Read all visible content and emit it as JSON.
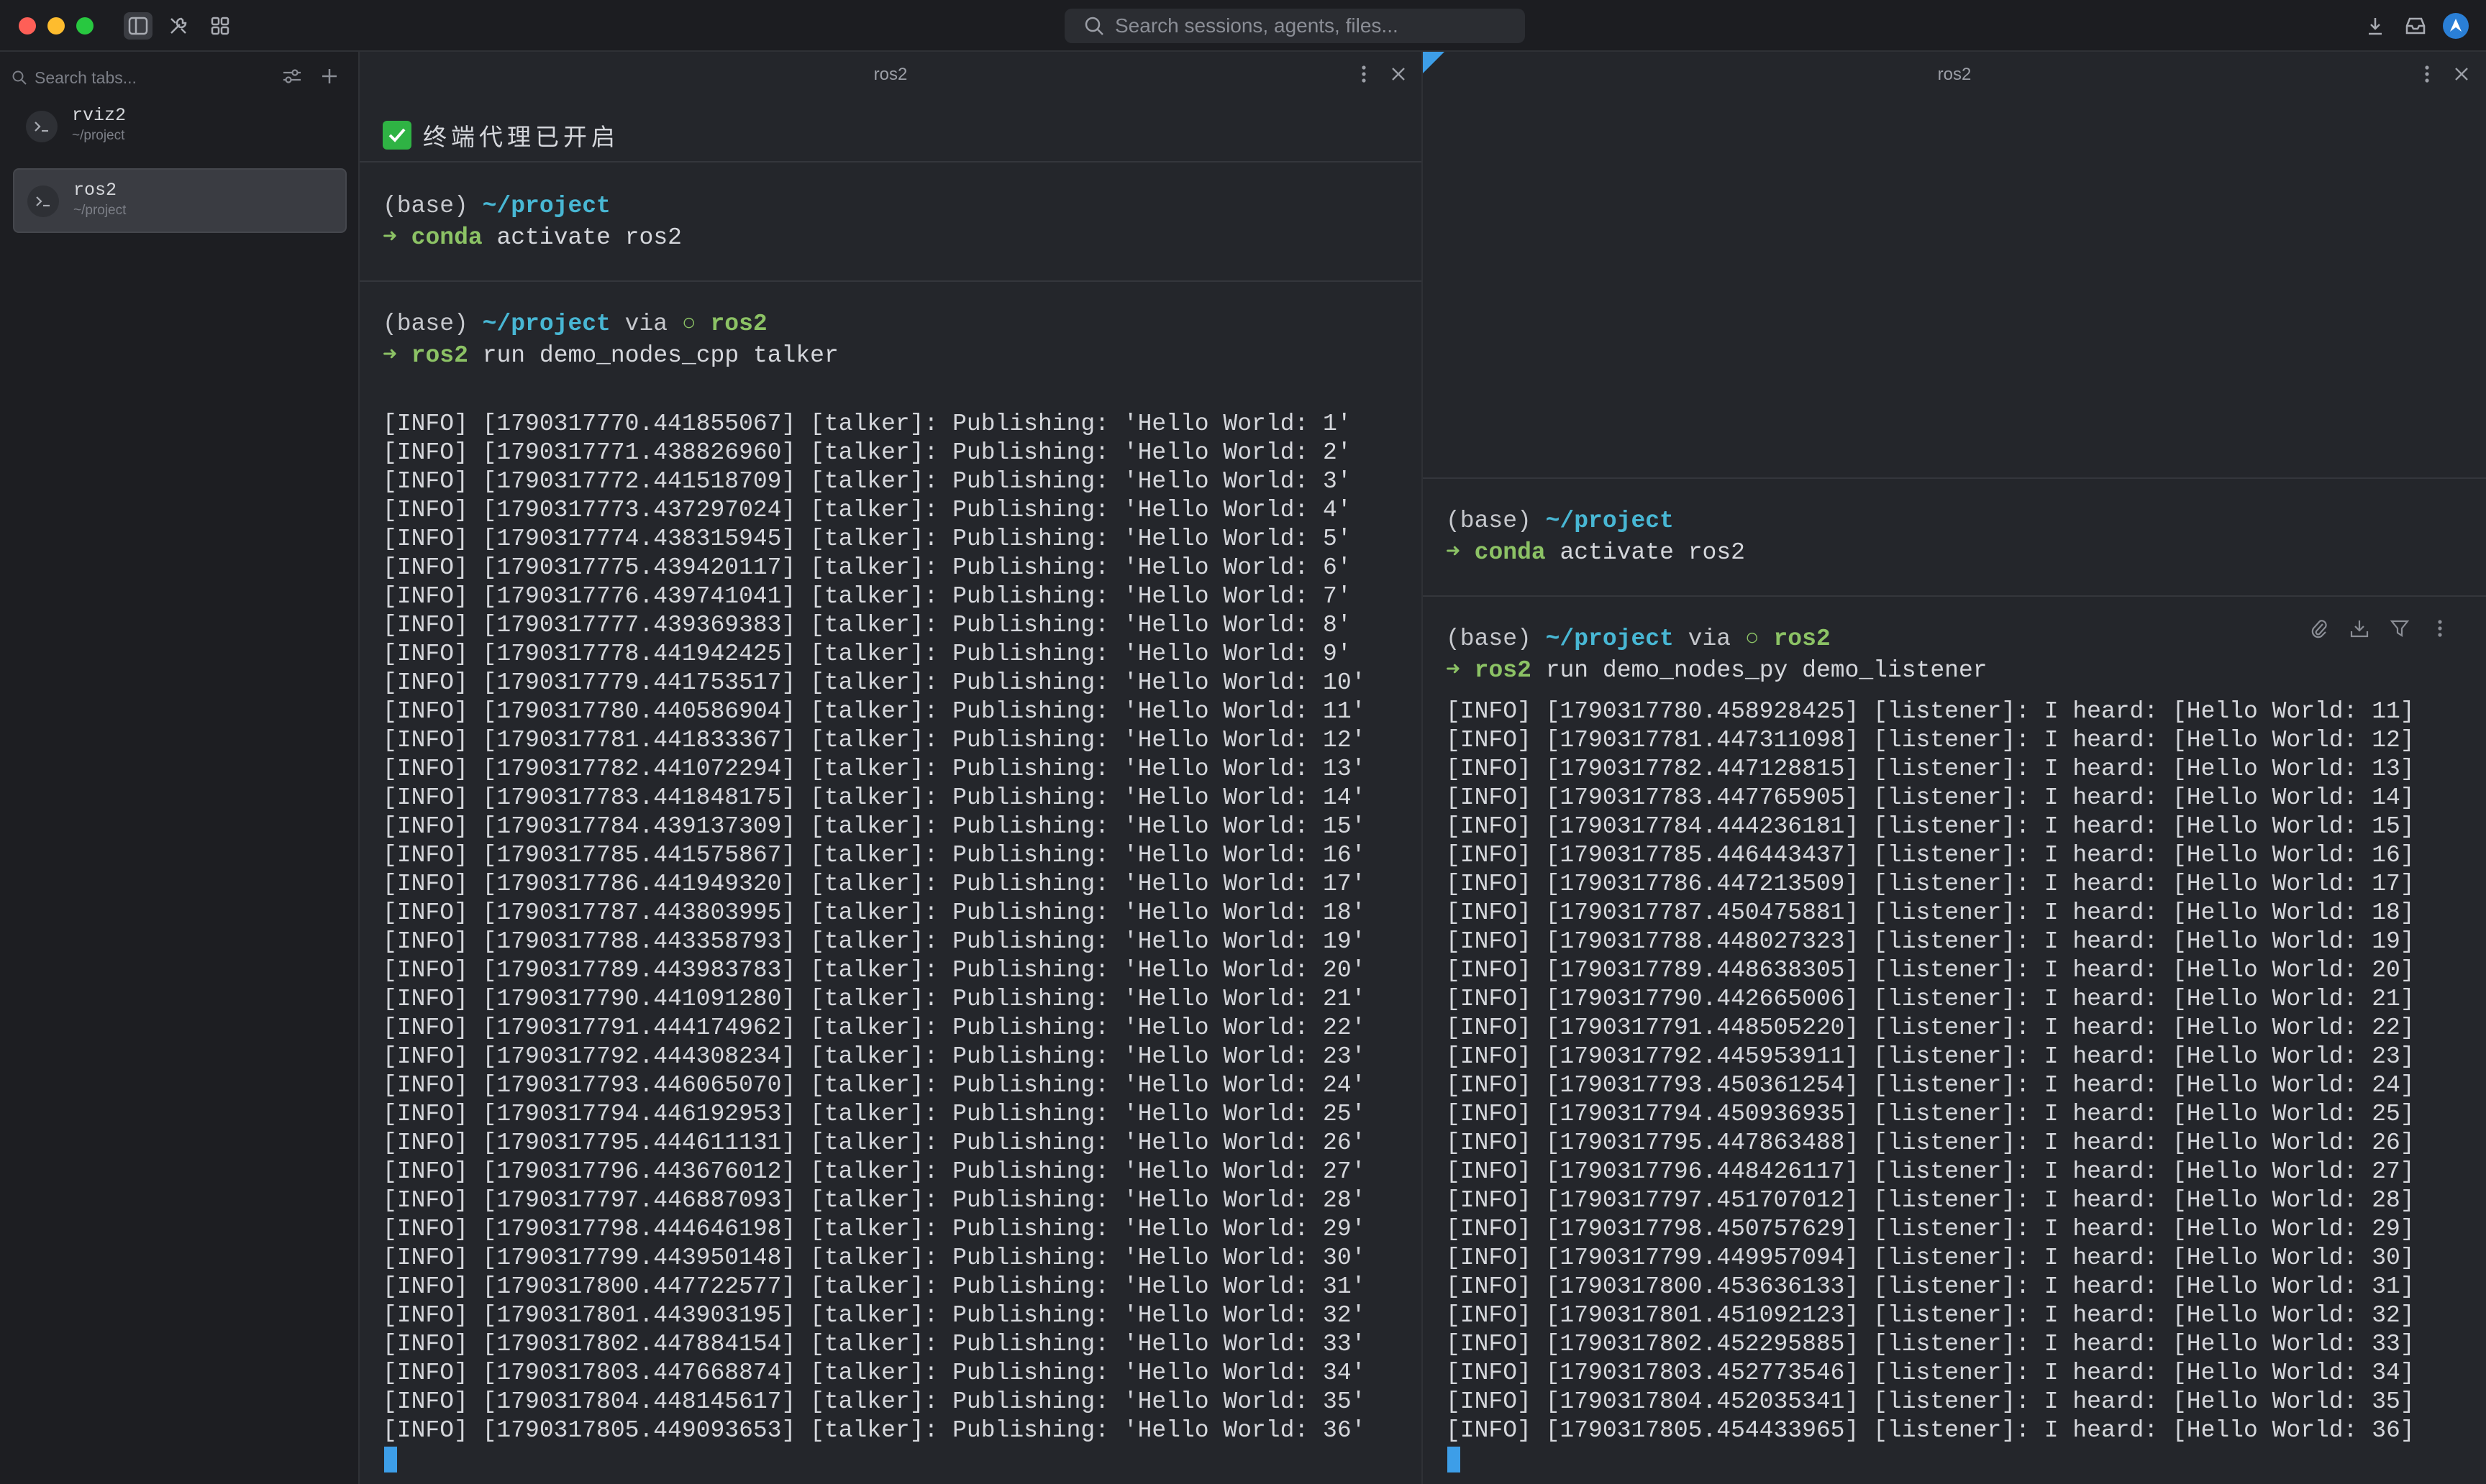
{
  "search": {
    "placeholder": "Search sessions, agents, files..."
  },
  "sidebar": {
    "search_placeholder": "Search tabs...",
    "sessions": [
      {
        "name": "rviz2",
        "path": "~/project",
        "active": false
      },
      {
        "name": "ros2",
        "path": "~/project",
        "active": true
      }
    ]
  },
  "left_pane": {
    "title": "ros2",
    "agent_banner": "终端代理已开启",
    "block1": {
      "prefix": "(base) ",
      "path": "~/project",
      "arrow": "➜ ",
      "cmd": "conda",
      "args": " activate ros2"
    },
    "block2": {
      "prefix": "(base) ",
      "path": "~/project",
      "via": " via ",
      "sym": "○ ",
      "env": "ros2",
      "arrow": "➜ ",
      "cmd": "ros2",
      "args": " run demo_nodes_cpp talker"
    },
    "logs": [
      "[INFO] [1790317770.441855067] [talker]: Publishing: 'Hello World: 1'",
      "[INFO] [1790317771.438826960] [talker]: Publishing: 'Hello World: 2'",
      "[INFO] [1790317772.441518709] [talker]: Publishing: 'Hello World: 3'",
      "[INFO] [1790317773.437297024] [talker]: Publishing: 'Hello World: 4'",
      "[INFO] [1790317774.438315945] [talker]: Publishing: 'Hello World: 5'",
      "[INFO] [1790317775.439420117] [talker]: Publishing: 'Hello World: 6'",
      "[INFO] [1790317776.439741041] [talker]: Publishing: 'Hello World: 7'",
      "[INFO] [1790317777.439369383] [talker]: Publishing: 'Hello World: 8'",
      "[INFO] [1790317778.441942425] [talker]: Publishing: 'Hello World: 9'",
      "[INFO] [1790317779.441753517] [talker]: Publishing: 'Hello World: 10'",
      "[INFO] [1790317780.440586904] [talker]: Publishing: 'Hello World: 11'",
      "[INFO] [1790317781.441833367] [talker]: Publishing: 'Hello World: 12'",
      "[INFO] [1790317782.441072294] [talker]: Publishing: 'Hello World: 13'",
      "[INFO] [1790317783.441848175] [talker]: Publishing: 'Hello World: 14'",
      "[INFO] [1790317784.439137309] [talker]: Publishing: 'Hello World: 15'",
      "[INFO] [1790317785.441575867] [talker]: Publishing: 'Hello World: 16'",
      "[INFO] [1790317786.441949320] [talker]: Publishing: 'Hello World: 17'",
      "[INFO] [1790317787.443803995] [talker]: Publishing: 'Hello World: 18'",
      "[INFO] [1790317788.443358793] [talker]: Publishing: 'Hello World: 19'",
      "[INFO] [1790317789.443983783] [talker]: Publishing: 'Hello World: 20'",
      "[INFO] [1790317790.441091280] [talker]: Publishing: 'Hello World: 21'",
      "[INFO] [1790317791.444174962] [talker]: Publishing: 'Hello World: 22'",
      "[INFO] [1790317792.444308234] [talker]: Publishing: 'Hello World: 23'",
      "[INFO] [1790317793.446065070] [talker]: Publishing: 'Hello World: 24'",
      "[INFO] [1790317794.446192953] [talker]: Publishing: 'Hello World: 25'",
      "[INFO] [1790317795.444611131] [talker]: Publishing: 'Hello World: 26'",
      "[INFO] [1790317796.443676012] [talker]: Publishing: 'Hello World: 27'",
      "[INFO] [1790317797.446887093] [talker]: Publishing: 'Hello World: 28'",
      "[INFO] [1790317798.444646198] [talker]: Publishing: 'Hello World: 29'",
      "[INFO] [1790317799.443950148] [talker]: Publishing: 'Hello World: 30'",
      "[INFO] [1790317800.447722577] [talker]: Publishing: 'Hello World: 31'",
      "[INFO] [1790317801.443903195] [talker]: Publishing: 'Hello World: 32'",
      "[INFO] [1790317802.447884154] [talker]: Publishing: 'Hello World: 33'",
      "[INFO] [1790317803.447668874] [talker]: Publishing: 'Hello World: 34'",
      "[INFO] [1790317804.448145617] [talker]: Publishing: 'Hello World: 35'",
      "[INFO] [1790317805.449093653] [talker]: Publishing: 'Hello World: 36'"
    ]
  },
  "right_pane": {
    "title": "ros2",
    "block1": {
      "prefix": "(base) ",
      "path": "~/project",
      "arrow": "➜ ",
      "cmd": "conda",
      "args": " activate ros2"
    },
    "block2": {
      "prefix": "(base) ",
      "path": "~/project",
      "via": " via ",
      "sym": "○ ",
      "env": "ros2",
      "arrow": "➜ ",
      "cmd": "ros2",
      "args": " run demo_nodes_py demo_listener"
    },
    "logs": [
      "[INFO] [1790317780.458928425] [listener]: I heard: [Hello World: 11]",
      "[INFO] [1790317781.447311098] [listener]: I heard: [Hello World: 12]",
      "[INFO] [1790317782.447128815] [listener]: I heard: [Hello World: 13]",
      "[INFO] [1790317783.447765905] [listener]: I heard: [Hello World: 14]",
      "[INFO] [1790317784.444236181] [listener]: I heard: [Hello World: 15]",
      "[INFO] [1790317785.446443437] [listener]: I heard: [Hello World: 16]",
      "[INFO] [1790317786.447213509] [listener]: I heard: [Hello World: 17]",
      "[INFO] [1790317787.450475881] [listener]: I heard: [Hello World: 18]",
      "[INFO] [1790317788.448027323] [listener]: I heard: [Hello World: 19]",
      "[INFO] [1790317789.448638305] [listener]: I heard: [Hello World: 20]",
      "[INFO] [1790317790.442665006] [listener]: I heard: [Hello World: 21]",
      "[INFO] [1790317791.448505220] [listener]: I heard: [Hello World: 22]",
      "[INFO] [1790317792.445953911] [listener]: I heard: [Hello World: 23]",
      "[INFO] [1790317793.450361254] [listener]: I heard: [Hello World: 24]",
      "[INFO] [1790317794.450936935] [listener]: I heard: [Hello World: 25]",
      "[INFO] [1790317795.447863488] [listener]: I heard: [Hello World: 26]",
      "[INFO] [1790317796.448426117] [listener]: I heard: [Hello World: 27]",
      "[INFO] [1790317797.451707012] [listener]: I heard: [Hello World: 28]",
      "[INFO] [1790317798.450757629] [listener]: I heard: [Hello World: 29]",
      "[INFO] [1790317799.449957094] [listener]: I heard: [Hello World: 30]",
      "[INFO] [1790317800.453636133] [listener]: I heard: [Hello World: 31]",
      "[INFO] [1790317801.451092123] [listener]: I heard: [Hello World: 32]",
      "[INFO] [1790317802.452295885] [listener]: I heard: [Hello World: 33]",
      "[INFO] [1790317803.452773546] [listener]: I heard: [Hello World: 34]",
      "[INFO] [1790317804.452035341] [listener]: I heard: [Hello World: 35]",
      "[INFO] [1790317805.454433965] [listener]: I heard: [Hello World: 36]"
    ]
  },
  "colors": {
    "accent": "#3d9ee8",
    "path": "#48b7d4",
    "prompt_green": "#8cc265",
    "background": "#24262b"
  },
  "icons": {
    "titlebar": [
      "sidebar-toggle-icon",
      "tools-icon",
      "grid-icon",
      "search-icon",
      "download-icon",
      "inbox-icon",
      "app-logo-icon"
    ],
    "pane": [
      "more-icon",
      "close-icon"
    ],
    "block": [
      "attach-icon",
      "save-icon",
      "filter-icon",
      "more-icon"
    ]
  }
}
